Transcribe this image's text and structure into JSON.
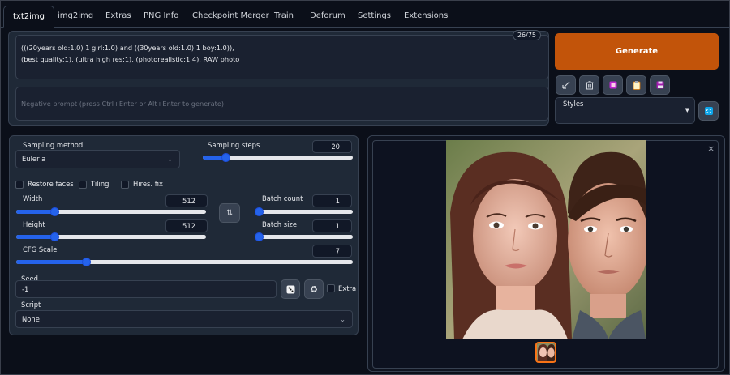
{
  "tabs": [
    "txt2img",
    "img2img",
    "Extras",
    "PNG Info",
    "Checkpoint Merger",
    "Train",
    "Deforum",
    "Settings",
    "Extensions"
  ],
  "prompt": {
    "text": "(((20years old:1.0) 1 girl:1.0) and ((30years old:1.0) 1 boy:1.0)),\n(best quality:1), (ultra high res:1), (photorealistic:1.4), RAW photo",
    "token_counter": "26/75",
    "negative_placeholder": "Negative prompt (press Ctrl+Enter or Alt+Enter to generate)"
  },
  "generate_label": "Generate",
  "styles_label": "Styles",
  "sampling": {
    "method_label": "Sampling method",
    "method_value": "Euler a",
    "steps_label": "Sampling steps",
    "steps_value": "20",
    "steps_fraction": 0.13
  },
  "checkboxes": {
    "restore_faces": "Restore faces",
    "tiling": "Tiling",
    "hires_fix": "Hires. fix"
  },
  "width": {
    "label": "Width",
    "value": "512",
    "fraction": 0.19
  },
  "height": {
    "label": "Height",
    "value": "512",
    "fraction": 0.19
  },
  "batch_count": {
    "label": "Batch count",
    "value": "1",
    "fraction": 0.0
  },
  "batch_size": {
    "label": "Batch size",
    "value": "1",
    "fraction": 0.0
  },
  "cfg": {
    "label": "CFG Scale",
    "value": "7",
    "fraction": 0.2
  },
  "seed": {
    "label": "Seed",
    "value": "-1",
    "extra_label": "Extra"
  },
  "script": {
    "label": "Script",
    "value": "None"
  },
  "colors": {
    "accent": "#2563eb",
    "generate": "#c2540a",
    "background": "#0b0f19",
    "panel": "#1f2937"
  }
}
